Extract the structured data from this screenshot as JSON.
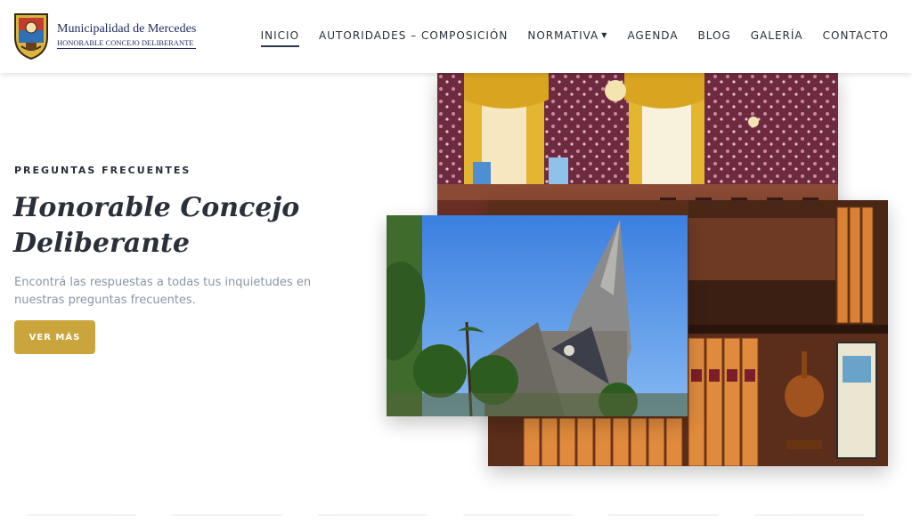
{
  "header": {
    "brand_title": "Municipalidad de Mercedes",
    "brand_subtitle": "HONORABLE CONCEJO DELIBERANTE",
    "nav": [
      {
        "label": "INICIO",
        "active": true
      },
      {
        "label": "AUTORIDADES – COMPOSICIÓN"
      },
      {
        "label": "NORMATIVA",
        "dropdown": true
      },
      {
        "label": "AGENDA"
      },
      {
        "label": "BLOG"
      },
      {
        "label": "GALERÍA"
      },
      {
        "label": "CONTACTO"
      }
    ]
  },
  "hero": {
    "eyebrow": "PREGUNTAS FRECUENTES",
    "title": "Honorable Concejo Deliberante",
    "description": "Encontrá las respuestas a todas tus inquietudes en nuestras preguntas frecuentes.",
    "button_label": "VER MÁS"
  },
  "colors": {
    "accent": "#c9a53c",
    "text_dark": "#2b2f3a",
    "text_muted": "#8a95a6",
    "brand_navy": "#1f2a5a"
  },
  "icons": {
    "logo": "crest-icon",
    "dropdown": "caret-down-icon"
  }
}
